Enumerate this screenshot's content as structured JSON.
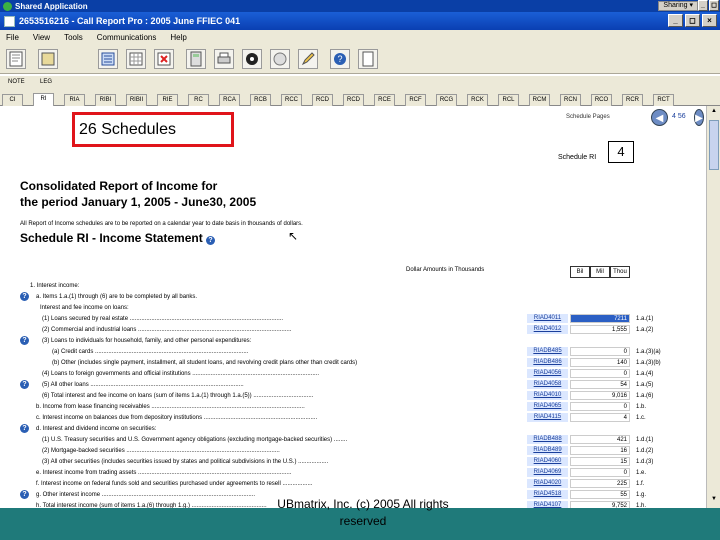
{
  "shared_bar": {
    "title": "Shared Application",
    "sharing_label": "Sharing ▾"
  },
  "title_bar": {
    "title": "2653516216 - Call Report Pro :  2005 June FFIEC 041"
  },
  "window_buttons": [
    "_",
    "◻",
    "×"
  ],
  "top_window_buttons": [
    "_",
    "◻",
    "×"
  ],
  "menu": [
    "File",
    "View",
    "Tools",
    "Communications",
    "Help"
  ],
  "tabs": {
    "top": [
      "NOTE",
      "LEG"
    ],
    "bottom": [
      "CI",
      "RI",
      "RIA",
      "RIBI",
      "RIBII",
      "RIE",
      "RC",
      "RCA",
      "RCB",
      "RCC",
      "RCD",
      "RCD",
      "RCE",
      "RCF",
      "RCG",
      "RCK",
      "RCL",
      "RCM",
      "RCN",
      "RCO",
      "RCR",
      "RCT"
    ],
    "active_index": 1
  },
  "callout": "26 Schedules",
  "schedule_link": "Schedule Pages",
  "page_number": "4 56",
  "schedule_label": "Schedule RI",
  "schedule_number": "4",
  "report_title_1": "Consolidated Report of Income for",
  "report_title_2": "the period January 1, 2005 - June30, 2005",
  "note": "All Report of Income schedules are to be reported on a calendar year to date basis in thousands of dollars.",
  "schedule_title": "Schedule RI - Income Statement",
  "dollar_header": "Dollar Amounts in Thousands",
  "col_headers": [
    "Bil",
    "Mil",
    "Thou"
  ],
  "rows": [
    {
      "label": "1. Interest income:",
      "code": "",
      "value": "",
      "item": "",
      "help": false
    },
    {
      "label": "a. Items 1.a.(1) through (6) are to be completed by all banks.",
      "code": "",
      "value": "",
      "item": "",
      "help": true
    },
    {
      "label": "Interest and fee income on loans:",
      "code": "",
      "value": "",
      "item": "",
      "help": false
    },
    {
      "label": "(1) Loans secured by real estate ............................................................................................",
      "code": "RIAD4011",
      "value": "7211",
      "item": "1.a.(1)",
      "help": false,
      "hl": true
    },
    {
      "label": "(2) Commercial and industrial loans ............................................................................................",
      "code": "RIAD4012",
      "value": "1,555",
      "item": "1.a.(2)",
      "help": false
    },
    {
      "label": "(3) Loans to individuals for household, family, and other personal expenditures:",
      "code": "",
      "value": "",
      "item": "",
      "help": true
    },
    {
      "label": "(a) Credit cards ............................................................................................",
      "code": "RIADB485",
      "value": "0",
      "item": "1.a.(3)(a)",
      "help": false
    },
    {
      "label": "(b) Other (includes single payment, installment, all student loans, and revolving credit plans other than credit cards)",
      "code": "RIADB486",
      "value": "140",
      "item": "1.a.(3)(b)",
      "help": false
    },
    {
      "label": "(4) Loans to foreign governments and official institutions ............................................................................",
      "code": "RIAD4056",
      "value": "0",
      "item": "1.a.(4)",
      "help": false
    },
    {
      "label": "(5) All other loans ............................................................................................",
      "code": "RIAD4058",
      "value": "54",
      "item": "1.a.(5)",
      "help": true
    },
    {
      "label": "(6) Total interest and fee income on loans (sum of items 1.a.(1) through 1.a.(5)) ....................................",
      "code": "RIAD4010",
      "value": "9,016",
      "item": "1.a.(6)",
      "help": false
    },
    {
      "label": "b. Income from lease financing receivables ............................................................................................",
      "code": "RIAD4065",
      "value": "0",
      "item": "1.b.",
      "help": false
    },
    {
      "label": "c. Interest income on balances due from depository institutions ....................................................................",
      "code": "RIAD4115",
      "value": "4",
      "item": "1.c.",
      "help": false
    },
    {
      "label": "d. Interest and dividend income on securities:",
      "code": "",
      "value": "",
      "item": "",
      "help": true
    },
    {
      "label": "(1) U.S. Treasury securities and U.S. Government agency obligations (excluding mortgage-backed securities) ........",
      "code": "RIADB488",
      "value": "421",
      "item": "1.d.(1)",
      "help": false
    },
    {
      "label": "(2) Mortgage-backed securities ............................................................................................",
      "code": "RIADB489",
      "value": "16",
      "item": "1.d.(2)",
      "help": false
    },
    {
      "label": "(3) All other securities (includes securities issued by states and political subdivisions in the U.S.) ..................",
      "code": "RIAD4060",
      "value": "15",
      "item": "1.d.(3)",
      "help": false
    },
    {
      "label": "e. Interest income from trading assets ............................................................................................",
      "code": "RIAD4069",
      "value": "0",
      "item": "1.e.",
      "help": false
    },
    {
      "label": "f. Interest income on federal funds sold and securities purchased under agreements to resell ..................",
      "code": "RIAD4020",
      "value": "225",
      "item": "1.f.",
      "help": false
    },
    {
      "label": "g. Other interest income ............................................................................................",
      "code": "RIAD4518",
      "value": "55",
      "item": "1.g.",
      "help": true
    },
    {
      "label": "h. Total interest income (sum of items 1.a.(6) through 1.g.) .............................................",
      "code": "RIAD4107",
      "value": "9,752",
      "item": "1.h.",
      "help": false
    }
  ],
  "footer": "UBmatrix, Inc. (c) 2005 All rights reserved"
}
